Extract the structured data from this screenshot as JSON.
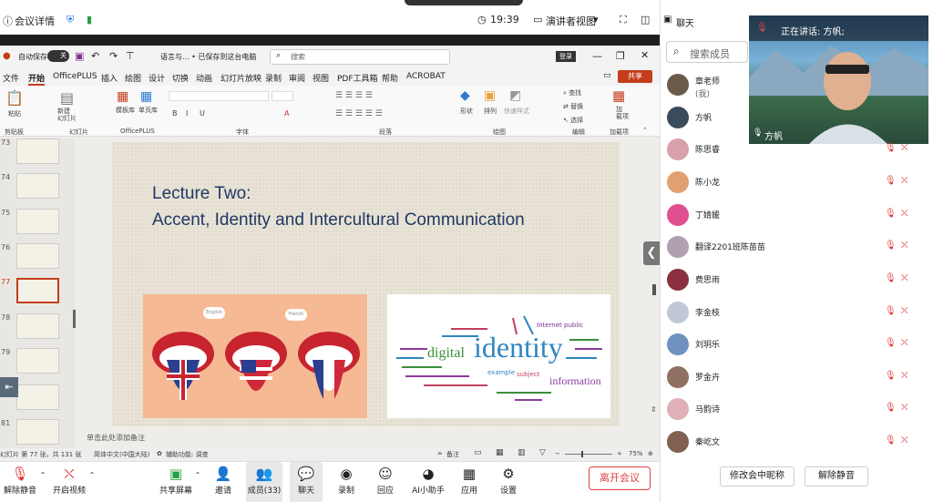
{
  "meeting": {
    "details": "会议详情",
    "time": "19:39",
    "presenter_view": "演讲者视图"
  },
  "ppt": {
    "autosave": "自动保存",
    "toggle": "关",
    "title": "语言与... • 已保存到这台电脑",
    "search_placeholder": "搜索",
    "login": "登录",
    "menu": [
      "文件",
      "开始",
      "OfficePLUS",
      "插入",
      "绘图",
      "设计",
      "切换",
      "动画",
      "幻灯片放映",
      "录制",
      "审阅",
      "视图",
      "PDF工具箱",
      "帮助",
      "ACROBAT"
    ],
    "share": "共享",
    "ribbon": {
      "paste": "粘贴",
      "clipboard": "剪贴板",
      "new_slide": "新建\n幻灯片",
      "slides": "幻灯片",
      "template": "模板库",
      "single": "单页库",
      "officeplus": "OfficePLUS",
      "font": "字体",
      "paragraph": "段落",
      "shape": "形状",
      "arrange": "排列",
      "quick": "快速样式",
      "drawing": "绘图",
      "find": "查找",
      "replace": "替换",
      "select": "选择",
      "editing": "编辑",
      "addin": "加\n载项",
      "addins": "加载项"
    },
    "slide_numbers": [
      "73",
      "74",
      "75",
      "76",
      "77",
      "78",
      "79",
      "80",
      "81"
    ],
    "slide": {
      "line1": "Lecture Two:",
      "line2": "Accent, Identity and Intercultural Communication",
      "bubble1": "English",
      "bubble2": "French",
      "wc_identity": "identity",
      "wc_digital": "digital",
      "wc_information": "information",
      "wc_internet": "Internet public",
      "wc_subject": "subject",
      "wc_example": "example"
    },
    "notes": "单击此处添加备注",
    "status": {
      "slide": "幻灯片 第 77 张，共 131 张",
      "lang": "简体中文(中国大陆)",
      "access": "辅助功能: 调查",
      "notes": "备注",
      "zoom": "75%"
    }
  },
  "toolbar": {
    "mute": "解除静音",
    "video": "开启视频",
    "share": "共享屏幕",
    "invite": "邀请",
    "members": "成员(33)",
    "chat": "聊天",
    "record": "录制",
    "reply": "回应",
    "ai": "AI小助手",
    "apps": "应用",
    "settings": "设置",
    "leave": "离开会议"
  },
  "panel": {
    "chat_title": "聊天",
    "search_placeholder": "搜索成员",
    "speaking": "正在讲话: 方帆;",
    "video_name": "方帆",
    "members": [
      {
        "name": "章老师",
        "sub": "(我)",
        "color": "#6b5a4a"
      },
      {
        "name": "方帆",
        "sub": "",
        "color": "#3a4b5c"
      },
      {
        "name": "陈思睿",
        "sub": "",
        "color": "#d8a0a8"
      },
      {
        "name": "陈小龙",
        "sub": "",
        "color": "#e0a070"
      },
      {
        "name": "丁婧媛",
        "sub": "",
        "color": "#e05090"
      },
      {
        "name": "翻译2201班陈苗苗",
        "sub": "",
        "color": "#b0a0b0"
      },
      {
        "name": "费思雨",
        "sub": "",
        "color": "#8a3040"
      },
      {
        "name": "李金枝",
        "sub": "",
        "color": "#c0c8d8"
      },
      {
        "name": "刘玥乐",
        "sub": "",
        "color": "#7090c0"
      },
      {
        "name": "罗金卉",
        "sub": "",
        "color": "#907060"
      },
      {
        "name": "马韵诗",
        "sub": "",
        "color": "#e0b0b8"
      },
      {
        "name": "秦屹文",
        "sub": "",
        "color": "#806050"
      }
    ],
    "rename": "修改会中昵称",
    "unmute": "解除静音"
  }
}
